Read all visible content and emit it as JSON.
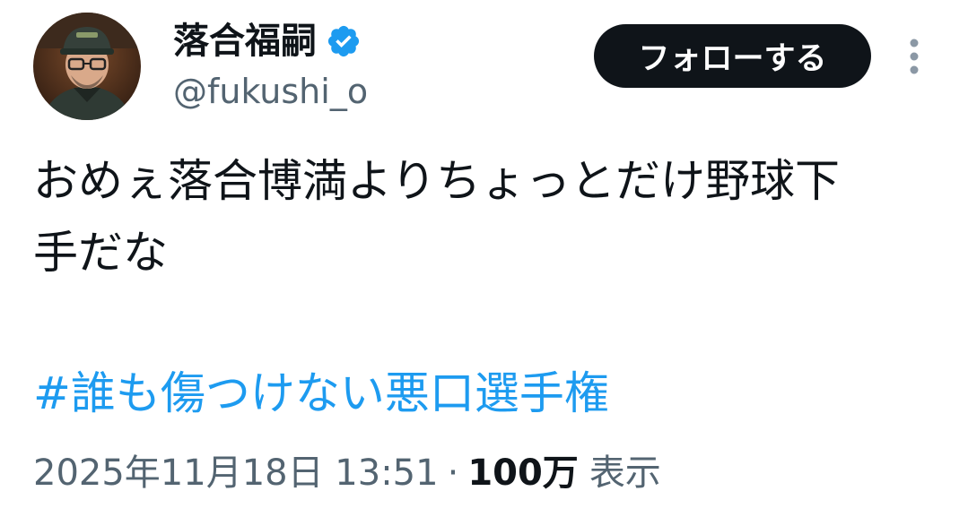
{
  "author": {
    "display_name": "落合福嗣",
    "handle": "@fukushi_o",
    "verified_badge_icon": "verified-check-icon",
    "badge_color": "#1d9bf0"
  },
  "actions": {
    "follow_label": "フォローする",
    "more_icon": "vertical-ellipsis-icon"
  },
  "tweet": {
    "text": "おめぇ落合博満よりちょっとだけ野球下\n手だな",
    "hashtag": "#誰も傷つけない悪口選手権"
  },
  "meta": {
    "timestamp": "2025年11月18日 13:51",
    "separator": "·",
    "views_count": "100万",
    "views_label": "表示"
  },
  "colors": {
    "text_primary": "#0f1419",
    "text_secondary": "#536471",
    "accent_blue": "#1d9bf0",
    "button_bg": "#0f1419"
  }
}
